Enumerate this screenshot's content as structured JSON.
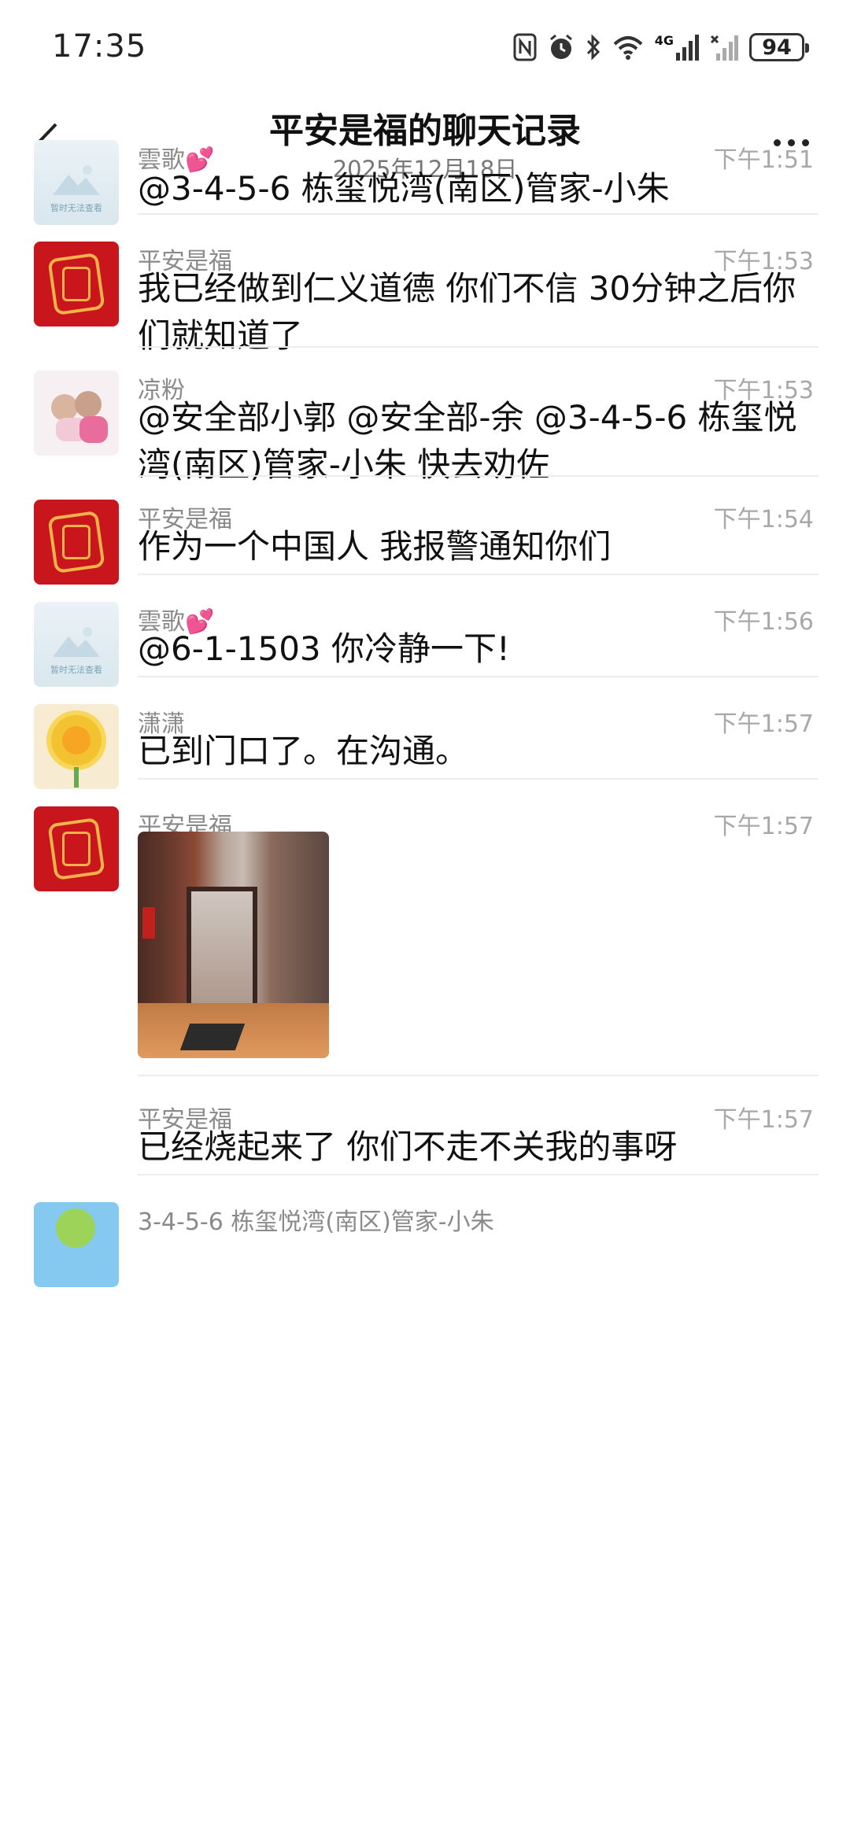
{
  "status_bar": {
    "time": "17:35",
    "network_label": "4G",
    "battery": "94"
  },
  "header": {
    "title": "平安是福的聊天记录",
    "date": "2025年12月18日"
  },
  "messages": [
    {
      "sender": "雲歌💕",
      "time": "下午1:51",
      "text": "@3-4-5-6 栋玺悦湾(南区)管家-小朱",
      "avatar": "placeholder-avatar",
      "avatar_text": "暂时无法查看"
    },
    {
      "sender": "平安是福",
      "time": "下午1:53",
      "text": "我已经做到仁义道德 你们不信 30分钟之后你们就知道了",
      "avatar": "red-paper-cut-avatar"
    },
    {
      "sender": "凉粉",
      "time": "下午1:53",
      "text": "@安全部小郭 @安全部-余 @3-4-5-6 栋玺悦湾(南区)管家-小朱 快去劝佐",
      "avatar": "children-photo-avatar"
    },
    {
      "sender": "平安是福",
      "time": "下午1:54",
      "text": "作为一个中国人 我报警通知你们",
      "avatar": "red-paper-cut-avatar"
    },
    {
      "sender": "雲歌💕",
      "time": "下午1:56",
      "text": "@6-1-1503 你冷静一下!",
      "avatar": "placeholder-avatar",
      "avatar_text": "暂时无法查看"
    },
    {
      "sender": "潇潇",
      "time": "下午1:57",
      "text": "已到门口了。在沟通。",
      "avatar": "sunflower-avatar"
    },
    {
      "sender": "平安是福",
      "time": "下午1:57",
      "text": "",
      "avatar": "red-paper-cut-avatar",
      "image": "hallway-doorway-photo"
    },
    {
      "sender": "平安是福",
      "time": "下午1:57",
      "text": "已经烧起来了 你们不走不关我的事呀",
      "avatar": ""
    },
    {
      "sender": "3-4-5-6 栋玺悦湾(南区)管家-小朱",
      "time": "",
      "text": "",
      "avatar": "cartoon-sprout-avatar"
    }
  ]
}
